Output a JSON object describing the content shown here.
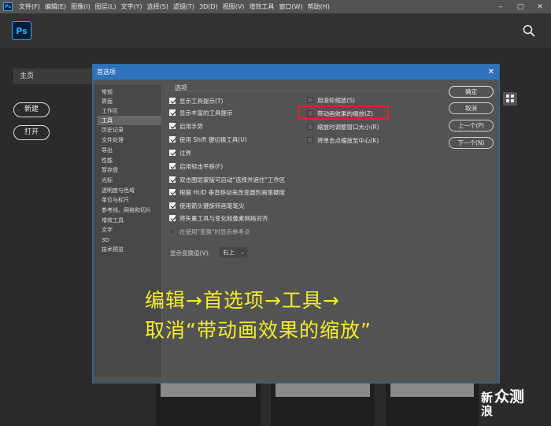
{
  "menubar": {
    "logo": "Ps",
    "items": [
      "文件(F)",
      "编辑(E)",
      "图像(I)",
      "图层(L)",
      "文字(Y)",
      "选择(S)",
      "滤镜(T)",
      "3D(D)",
      "视图(V)",
      "增效工具",
      "窗口(W)",
      "帮助(H)"
    ],
    "window_controls": [
      "–",
      "▢",
      "✕"
    ]
  },
  "home": {
    "logo": "Ps",
    "home_label": "主页",
    "new_label": "新建",
    "open_label": "打开",
    "watermark_line1": "新",
    "watermark_line2": "浪",
    "watermark_brand": "众测"
  },
  "dialog": {
    "title": "首选项",
    "close_glyph": "✕",
    "nav_items": [
      "常规",
      "界面",
      "工作区",
      "工具",
      "历史记录",
      "文件处理",
      "导出",
      "性能",
      "暂存盘",
      "光标",
      "透明度与色域",
      "单位与标尺",
      "参考线、网格和切片",
      "增效工具",
      "文字",
      "3D",
      "技术预览"
    ],
    "nav_selected_index": 3,
    "section_label": "选项",
    "left_options": [
      {
        "label": "显示工具提示(T)",
        "checked": true
      },
      {
        "label": "显示丰富的工具提示",
        "checked": true
      },
      {
        "label": "启用手势",
        "checked": true
      },
      {
        "label": "使用 Shift 键切换工具(U)",
        "checked": true
      },
      {
        "label": "过界",
        "checked": true
      },
      {
        "label": "启用轻击平移(F)",
        "checked": true
      },
      {
        "label": "双击图层蒙版可启动\"选择并遮住\"工作区",
        "checked": true
      },
      {
        "label": "根据 HUD 垂直移动来改变圆形画笔硬度",
        "checked": true
      },
      {
        "label": "使用箭头键旋转画笔笔尖",
        "checked": true
      },
      {
        "label": "将矢量工具与变化和像素网格对齐",
        "checked": true
      },
      {
        "label": "在使用\"变换\"时显示参考点",
        "checked": false
      }
    ],
    "right_options": [
      {
        "label": "用滚轮缩放(S)",
        "checked": false
      },
      {
        "label": "带动画效果的缩放(Z)",
        "checked": false
      },
      {
        "label": "缩放时调整窗口大小(R)",
        "checked": false
      },
      {
        "label": "将单击点缩放至中心(K)",
        "checked": false
      }
    ],
    "transform_label": "显示变换值(V):",
    "transform_value": "右上",
    "buttons": {
      "ok": "确定",
      "cancel": "取消",
      "prev": "上一个(P)",
      "next": "下一个(N)"
    }
  },
  "caption": {
    "line1": "编辑→首选项→工具→",
    "line2": "取消“带动画效果的缩放”"
  },
  "colors": {
    "accent": "#2f74bb",
    "highlight": "#e3202b",
    "caption": "#f4ee2a"
  }
}
